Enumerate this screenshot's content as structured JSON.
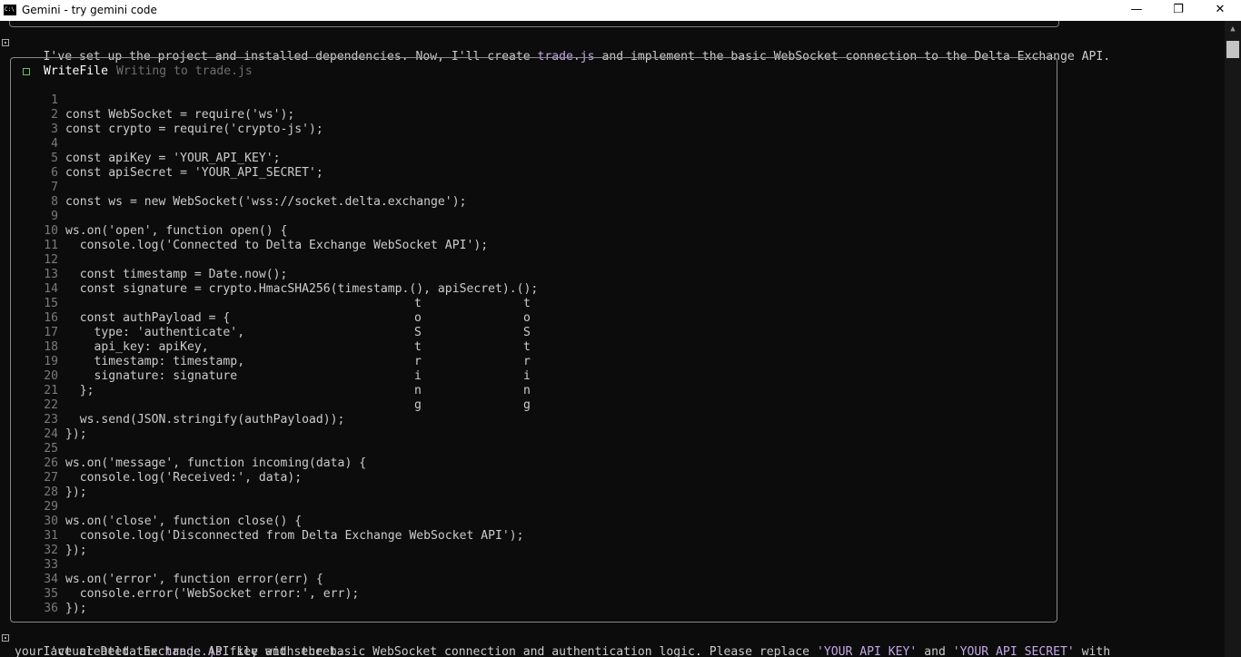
{
  "window": {
    "title": "Gemini - try gemini code",
    "icon_text": "C:\\",
    "minimize_glyph": "—",
    "restore_glyph": "❐",
    "close_glyph": "✕"
  },
  "messages": {
    "intro_parts": [
      "I've set up the project and installed dependencies. Now, I'll create ",
      "trade.js",
      " and implement the basic WebSocket connection to the Delta Exchange API."
    ],
    "final_parts": [
      "I've created the ",
      "trade.js",
      " file with the basic WebSocket connection and authentication logic. Please replace ",
      "'YOUR_API_KEY'",
      " and ",
      "'YOUR_API_SECRET'",
      " with"
    ],
    "final_line2": "your actual Delta Exchange API key and secret."
  },
  "tool_call": {
    "name": "WriteFile",
    "description": "Writing to trade.js"
  },
  "code_lines": [
    {
      "n": "1",
      "text": ""
    },
    {
      "n": "2",
      "text": "const WebSocket = require('ws');"
    },
    {
      "n": "3",
      "text": "const crypto = require('crypto-js');"
    },
    {
      "n": "4",
      "text": ""
    },
    {
      "n": "5",
      "text": "const apiKey = 'YOUR_API_KEY';"
    },
    {
      "n": "6",
      "text": "const apiSecret = 'YOUR_API_SECRET';"
    },
    {
      "n": "7",
      "text": ""
    },
    {
      "n": "8",
      "text": "const ws = new WebSocket('wss://socket.delta.exchange');"
    },
    {
      "n": "9",
      "text": ""
    },
    {
      "n": "10",
      "text": "ws.on('open', function open() {"
    },
    {
      "n": "11",
      "text": "  console.log('Connected to Delta Exchange WebSocket API');"
    },
    {
      "n": "12",
      "text": ""
    },
    {
      "n": "13",
      "text": "  const timestamp = Date.now();"
    },
    {
      "n": "14",
      "text": "  const signature = crypto.HmacSHA256(timestamp.(), apiSecret).();"
    },
    {
      "n": "15",
      "text": ""
    },
    {
      "n": "16",
      "text": "  const authPayload = {"
    },
    {
      "n": "17",
      "text": "    type: 'authenticate',"
    },
    {
      "n": "18",
      "text": "    api_key: apiKey,"
    },
    {
      "n": "19",
      "text": "    timestamp: timestamp,"
    },
    {
      "n": "20",
      "text": "    signature: signature"
    },
    {
      "n": "21",
      "text": "  };"
    },
    {
      "n": "22",
      "text": ""
    },
    {
      "n": "23",
      "text": "  ws.send(JSON.stringify(authPayload));"
    },
    {
      "n": "24",
      "text": "});"
    },
    {
      "n": "25",
      "text": ""
    },
    {
      "n": "26",
      "text": "ws.on('message', function incoming(data) {"
    },
    {
      "n": "27",
      "text": "  console.log('Received:', data);"
    },
    {
      "n": "28",
      "text": "});"
    },
    {
      "n": "29",
      "text": ""
    },
    {
      "n": "30",
      "text": "ws.on('close', function close() {"
    },
    {
      "n": "31",
      "text": "  console.log('Disconnected from Delta Exchange WebSocket API');"
    },
    {
      "n": "32",
      "text": "});"
    },
    {
      "n": "33",
      "text": ""
    },
    {
      "n": "34",
      "text": "ws.on('error', function error(err) {"
    },
    {
      "n": "35",
      "text": "  console.error('WebSocket error:', err);"
    },
    {
      "n": "36",
      "text": "});"
    }
  ],
  "vertical_text": [
    "t",
    "o",
    "S",
    "t",
    "r",
    "i",
    "n",
    "g"
  ],
  "colors": {
    "terminal_bg": "#0c0c0c",
    "text": "#cccccc",
    "highlight": "#c4a7e7",
    "tool_name": "#ffffff",
    "tool_desc": "#6e6e6e",
    "line_numbers": "#7a7a7a",
    "success_icon": "#6fc060"
  }
}
